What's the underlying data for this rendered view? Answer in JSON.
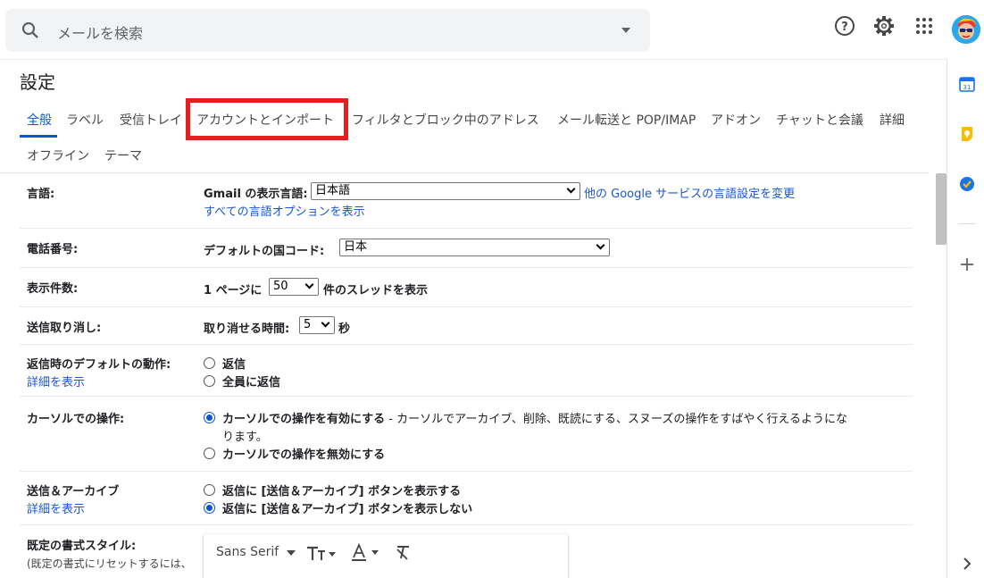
{
  "search": {
    "placeholder": "メールを検索"
  },
  "header": {
    "icons": [
      "help-icon",
      "settings-gear-icon",
      "apps-grid-icon",
      "account-avatar"
    ]
  },
  "settings": {
    "title": "設定",
    "tabs": [
      {
        "label": "全般"
      },
      {
        "label": "ラベル"
      },
      {
        "label": "受信トレイ"
      },
      {
        "label": "アカウントとインポート"
      },
      {
        "label": "フィルタとブロック中のアドレス"
      },
      {
        "label": "メール転送と POP/IMAP"
      },
      {
        "label": "アドオン"
      },
      {
        "label": "チャットと会議"
      },
      {
        "label": "詳細"
      },
      {
        "label": "オフライン"
      },
      {
        "label": "テーマ"
      }
    ]
  },
  "rows": {
    "language": {
      "label": "言語:",
      "display_label": "Gmail の表示言語:",
      "display_value": "日本語",
      "other_link": "他の Google サービスの言語設定を変更",
      "all_options_link": "すべての言語オプションを表示"
    },
    "phone": {
      "label": "電話番号:",
      "country_label": "デフォルトの国コード:",
      "country_value": "日本"
    },
    "page_size": {
      "label": "表示件数:",
      "prefix": "1 ページに",
      "value": "50",
      "suffix": "件のスレッドを表示"
    },
    "undo_send": {
      "label": "送信取り消し:",
      "prefix": "取り消せる時間:",
      "value": "5",
      "suffix": "秒"
    },
    "reply_default": {
      "label": "返信時のデフォルトの動作:",
      "details": "詳細を表示",
      "opt1": "返信",
      "opt2": "全員に返信"
    },
    "cursor": {
      "label": "カーソルでの操作:",
      "opt1": "カーソルでの操作を有効にする",
      "opt1_desc": " - カーソルでアーカイブ、削除、既読にする、スヌーズの操作をすばやく行えるようにな",
      "opt1_desc2": "ります。",
      "opt2": "カーソルでの操作を無効にする"
    },
    "send_archive": {
      "label": "送信＆アーカイブ",
      "details": "詳細を表示",
      "opt1": "返信に [送信＆アーカイブ] ボタンを表示する",
      "opt2": "返信に [送信＆アーカイブ] ボタンを表示しない"
    },
    "default_style": {
      "label": "既定の書式スタイル:",
      "note": "(既定の書式にリセットするには、",
      "font": "Sans Serif"
    }
  }
}
